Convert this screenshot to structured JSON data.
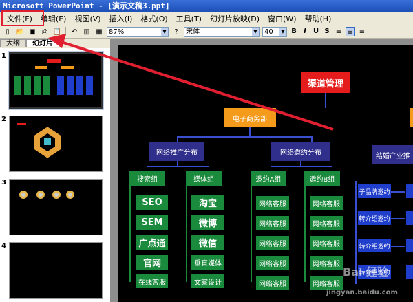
{
  "window": {
    "title": "Microsoft PowerPoint - [演示文稿3.ppt]"
  },
  "menu": [
    "文件(F)",
    "编辑(E)",
    "视图(V)",
    "插入(I)",
    "格式(O)",
    "工具(T)",
    "幻灯片放映(D)",
    "窗口(W)",
    "帮助(H)"
  ],
  "toolbar": {
    "zoom": "87%",
    "font": "宋体",
    "font_size": "40",
    "bold": "B",
    "italic": "I",
    "underline": "U",
    "shadow": "S"
  },
  "panel": {
    "tab_outline": "大纲",
    "tab_slides": "幻灯片",
    "slide_numbers": [
      "1",
      "2",
      "3",
      "4"
    ]
  },
  "slide": {
    "root": "渠道管理",
    "dept": "电子商务部",
    "level2": [
      "网络推广分布",
      "网络邀约分布"
    ],
    "level2_right": "结婚产业推",
    "groups": [
      "搜索组",
      "媒体组",
      "邀约A组",
      "邀约B组"
    ],
    "search_items": [
      "SEO",
      "SEM",
      "广点通",
      "官网",
      "在线客服"
    ],
    "media_items": [
      "淘宝",
      "微博",
      "微信",
      "垂直媒体",
      "文案设计"
    ],
    "invite_a_items": [
      "网络客服",
      "网络客服",
      "网络客服",
      "网络客服",
      "网络客服"
    ],
    "invite_b_items": [
      "网络客服",
      "网络客服",
      "网络客服",
      "网络客服",
      "网络客服"
    ],
    "right_items": [
      "子品牌邀约",
      "转介绍邀约",
      "转介绍邀约",
      "转介绍邀约"
    ]
  },
  "watermark": {
    "logo": "Bai 经验",
    "url": "jingyan.baidu.com"
  },
  "colors": {
    "annotation": "#e02030",
    "title_bar": "#1c4fb8"
  }
}
